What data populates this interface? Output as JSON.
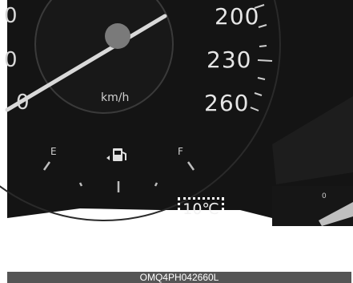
{
  "cluster": {
    "speed_labels": [
      "200",
      "230",
      "260"
    ],
    "left_edge_labels": [
      "0",
      "0",
      "0"
    ],
    "speed_unit": "km/h",
    "fuel_gauge": {
      "empty_label": "E",
      "full_label": "F",
      "icon": "fuel-pump-icon"
    },
    "outside_temperature": "10℃",
    "right_gauge_label": "0"
  },
  "caption": "OMQ4PH042660L",
  "colors": {
    "dial_background": "#141414",
    "needle": "#d9d9d9",
    "highlight_border": "#ffffff",
    "caption_bar": "#555555"
  }
}
